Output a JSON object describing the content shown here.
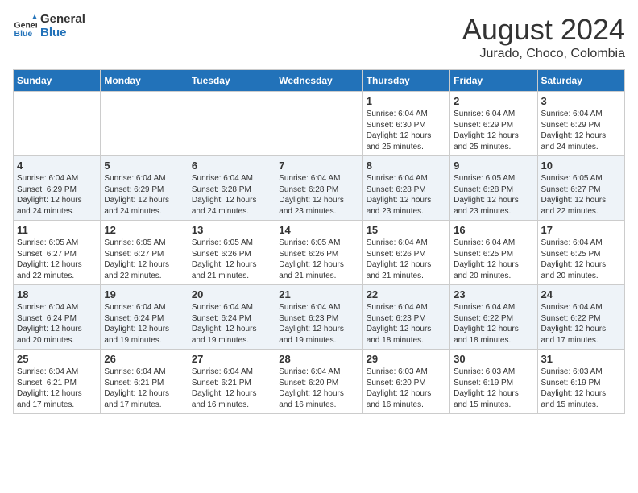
{
  "header": {
    "logo_line1": "General",
    "logo_line2": "Blue",
    "month": "August 2024",
    "location": "Jurado, Choco, Colombia"
  },
  "weekdays": [
    "Sunday",
    "Monday",
    "Tuesday",
    "Wednesday",
    "Thursday",
    "Friday",
    "Saturday"
  ],
  "weeks": [
    [
      null,
      null,
      null,
      null,
      {
        "day": "1",
        "sunrise": "6:04 AM",
        "sunset": "6:30 PM",
        "daylight": "12 hours and 25 minutes."
      },
      {
        "day": "2",
        "sunrise": "6:04 AM",
        "sunset": "6:29 PM",
        "daylight": "12 hours and 25 minutes."
      },
      {
        "day": "3",
        "sunrise": "6:04 AM",
        "sunset": "6:29 PM",
        "daylight": "12 hours and 24 minutes."
      }
    ],
    [
      {
        "day": "4",
        "sunrise": "6:04 AM",
        "sunset": "6:29 PM",
        "daylight": "12 hours and 24 minutes."
      },
      {
        "day": "5",
        "sunrise": "6:04 AM",
        "sunset": "6:29 PM",
        "daylight": "12 hours and 24 minutes."
      },
      {
        "day": "6",
        "sunrise": "6:04 AM",
        "sunset": "6:28 PM",
        "daylight": "12 hours and 24 minutes."
      },
      {
        "day": "7",
        "sunrise": "6:04 AM",
        "sunset": "6:28 PM",
        "daylight": "12 hours and 23 minutes."
      },
      {
        "day": "8",
        "sunrise": "6:04 AM",
        "sunset": "6:28 PM",
        "daylight": "12 hours and 23 minutes."
      },
      {
        "day": "9",
        "sunrise": "6:05 AM",
        "sunset": "6:28 PM",
        "daylight": "12 hours and 23 minutes."
      },
      {
        "day": "10",
        "sunrise": "6:05 AM",
        "sunset": "6:27 PM",
        "daylight": "12 hours and 22 minutes."
      }
    ],
    [
      {
        "day": "11",
        "sunrise": "6:05 AM",
        "sunset": "6:27 PM",
        "daylight": "12 hours and 22 minutes."
      },
      {
        "day": "12",
        "sunrise": "6:05 AM",
        "sunset": "6:27 PM",
        "daylight": "12 hours and 22 minutes."
      },
      {
        "day": "13",
        "sunrise": "6:05 AM",
        "sunset": "6:26 PM",
        "daylight": "12 hours and 21 minutes."
      },
      {
        "day": "14",
        "sunrise": "6:05 AM",
        "sunset": "6:26 PM",
        "daylight": "12 hours and 21 minutes."
      },
      {
        "day": "15",
        "sunrise": "6:04 AM",
        "sunset": "6:26 PM",
        "daylight": "12 hours and 21 minutes."
      },
      {
        "day": "16",
        "sunrise": "6:04 AM",
        "sunset": "6:25 PM",
        "daylight": "12 hours and 20 minutes."
      },
      {
        "day": "17",
        "sunrise": "6:04 AM",
        "sunset": "6:25 PM",
        "daylight": "12 hours and 20 minutes."
      }
    ],
    [
      {
        "day": "18",
        "sunrise": "6:04 AM",
        "sunset": "6:24 PM",
        "daylight": "12 hours and 20 minutes."
      },
      {
        "day": "19",
        "sunrise": "6:04 AM",
        "sunset": "6:24 PM",
        "daylight": "12 hours and 19 minutes."
      },
      {
        "day": "20",
        "sunrise": "6:04 AM",
        "sunset": "6:24 PM",
        "daylight": "12 hours and 19 minutes."
      },
      {
        "day": "21",
        "sunrise": "6:04 AM",
        "sunset": "6:23 PM",
        "daylight": "12 hours and 19 minutes."
      },
      {
        "day": "22",
        "sunrise": "6:04 AM",
        "sunset": "6:23 PM",
        "daylight": "12 hours and 18 minutes."
      },
      {
        "day": "23",
        "sunrise": "6:04 AM",
        "sunset": "6:22 PM",
        "daylight": "12 hours and 18 minutes."
      },
      {
        "day": "24",
        "sunrise": "6:04 AM",
        "sunset": "6:22 PM",
        "daylight": "12 hours and 17 minutes."
      }
    ],
    [
      {
        "day": "25",
        "sunrise": "6:04 AM",
        "sunset": "6:21 PM",
        "daylight": "12 hours and 17 minutes."
      },
      {
        "day": "26",
        "sunrise": "6:04 AM",
        "sunset": "6:21 PM",
        "daylight": "12 hours and 17 minutes."
      },
      {
        "day": "27",
        "sunrise": "6:04 AM",
        "sunset": "6:21 PM",
        "daylight": "12 hours and 16 minutes."
      },
      {
        "day": "28",
        "sunrise": "6:04 AM",
        "sunset": "6:20 PM",
        "daylight": "12 hours and 16 minutes."
      },
      {
        "day": "29",
        "sunrise": "6:03 AM",
        "sunset": "6:20 PM",
        "daylight": "12 hours and 16 minutes."
      },
      {
        "day": "30",
        "sunrise": "6:03 AM",
        "sunset": "6:19 PM",
        "daylight": "12 hours and 15 minutes."
      },
      {
        "day": "31",
        "sunrise": "6:03 AM",
        "sunset": "6:19 PM",
        "daylight": "12 hours and 15 minutes."
      }
    ]
  ]
}
